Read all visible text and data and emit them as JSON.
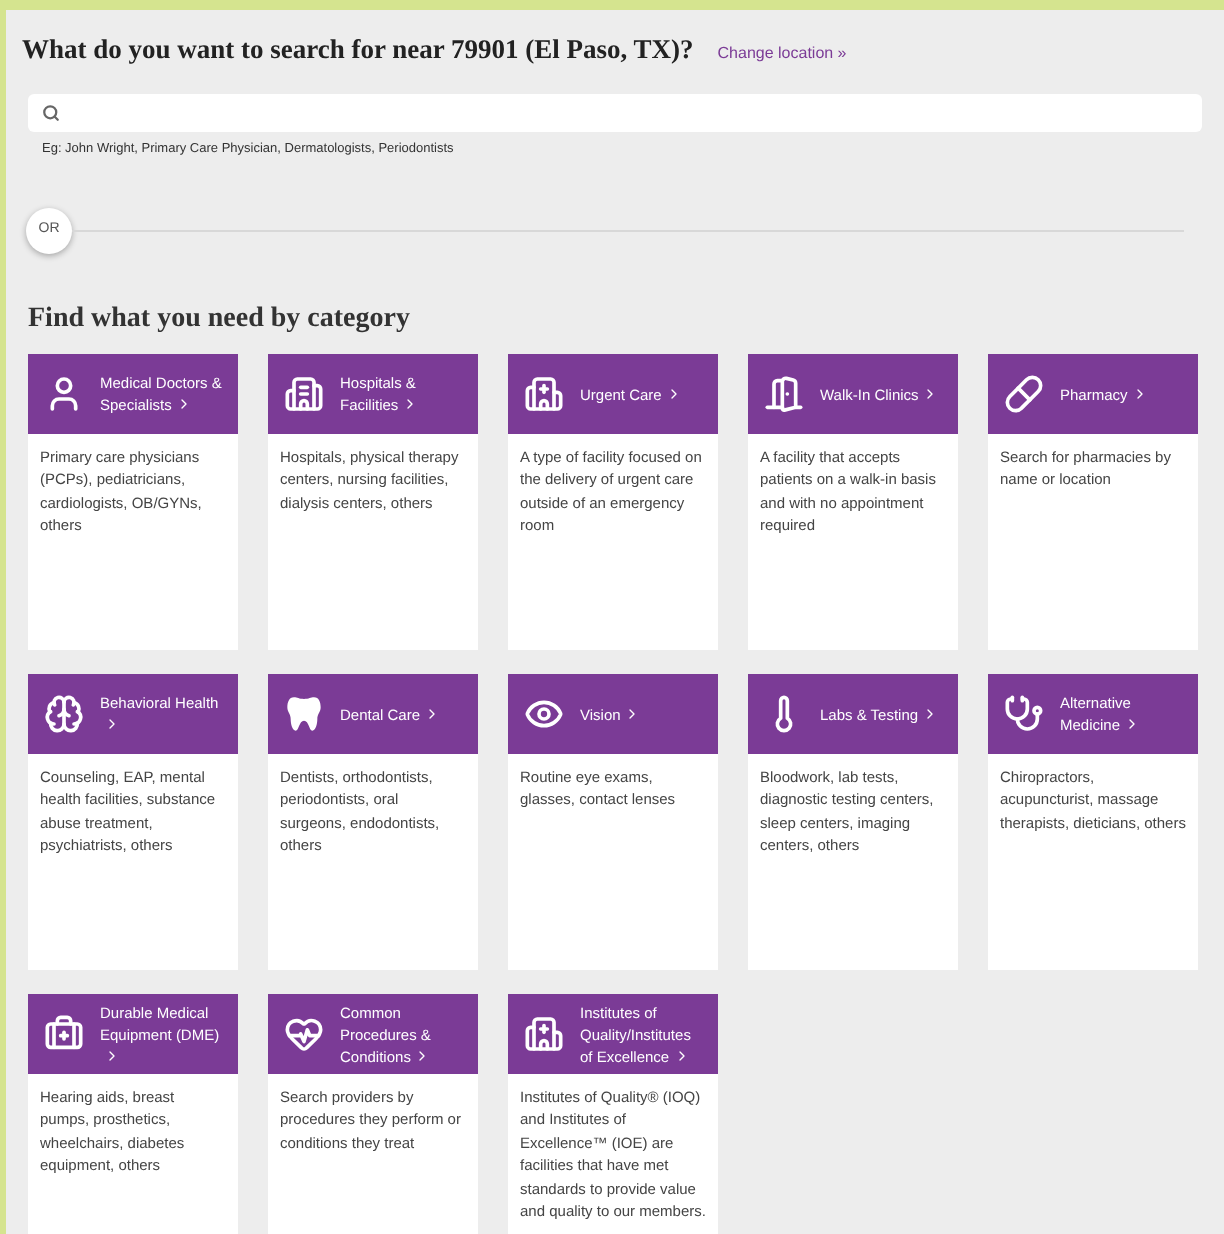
{
  "header": {
    "title": "What do you want to search for near 79901 (El Paso, TX)?",
    "change_location": "Change location »"
  },
  "search": {
    "hint": "Eg: John Wright, Primary Care Physician, Dermatologists, Periodontists"
  },
  "divider": {
    "label": "OR"
  },
  "categories_title": "Find what you need by category",
  "categories": [
    {
      "title": "Medical Doctors & Specialists",
      "description": "Primary care physicians (PCPs), pediatricians, cardiologists, OB/GYNs, others"
    },
    {
      "title": "Hospitals & Facilities",
      "description": "Hospitals, physical therapy centers, nursing facilities, dialysis centers, others"
    },
    {
      "title": "Urgent Care",
      "description": "A type of facility focused on the delivery of urgent care outside of an emergency room"
    },
    {
      "title": "Walk-In Clinics",
      "description": "A facility that accepts patients on a walk-in basis and with no appointment required"
    },
    {
      "title": "Pharmacy",
      "description": "Search for pharmacies by name or location"
    },
    {
      "title": "Behavioral Health",
      "description": "Counseling, EAP, mental health facilities, substance abuse treatment, psychiatrists, others"
    },
    {
      "title": "Dental Care",
      "description": "Dentists, orthodontists, periodontists, oral surgeons, endodontists, others"
    },
    {
      "title": "Vision",
      "description": "Routine eye exams, glasses, contact lenses"
    },
    {
      "title": "Labs & Testing",
      "description": "Bloodwork, lab tests, diagnostic testing centers, sleep centers, imaging centers, others"
    },
    {
      "title": "Alternative Medicine",
      "description": "Chiropractors, acupuncturist, massage therapists, dieticians, others"
    },
    {
      "title": "Durable Medical Equipment (DME)",
      "description": "Hearing aids, breast pumps, prosthetics, wheelchairs, diabetes equipment, others"
    },
    {
      "title": "Common Procedures & Conditions",
      "description": "Search providers by procedures they perform or conditions they treat"
    },
    {
      "title": "Institutes of Quality/Institutes of Excellence",
      "description": "Institutes of Quality® (IOQ) and Institutes of Excellence™ (IOE) are facilities that have met standards to provide value and quality to our members."
    }
  ]
}
